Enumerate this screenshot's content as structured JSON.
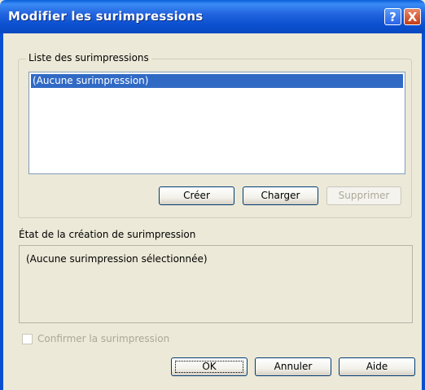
{
  "window": {
    "title": "Modifier les surimpressions"
  },
  "titlebar": {
    "help_glyph": "?",
    "close_glyph": "X"
  },
  "list_group": {
    "legend": "Liste des surimpressions",
    "items": [
      "(Aucune surimpression)"
    ]
  },
  "list_buttons": {
    "create": "Créer",
    "load": "Charger",
    "delete": "Supprimer"
  },
  "status": {
    "label": "État de la création de surimpression",
    "text": "(Aucune surimpression sélectionnée)"
  },
  "confirm": {
    "label": "Confirmer la surimpression",
    "checked": false
  },
  "dialog_buttons": {
    "ok": "OK",
    "cancel": "Annuler",
    "help": "Aide"
  },
  "colors": {
    "titlebar": "#0b4fd0",
    "selection": "#316ac5",
    "face": "#ece9d8"
  }
}
